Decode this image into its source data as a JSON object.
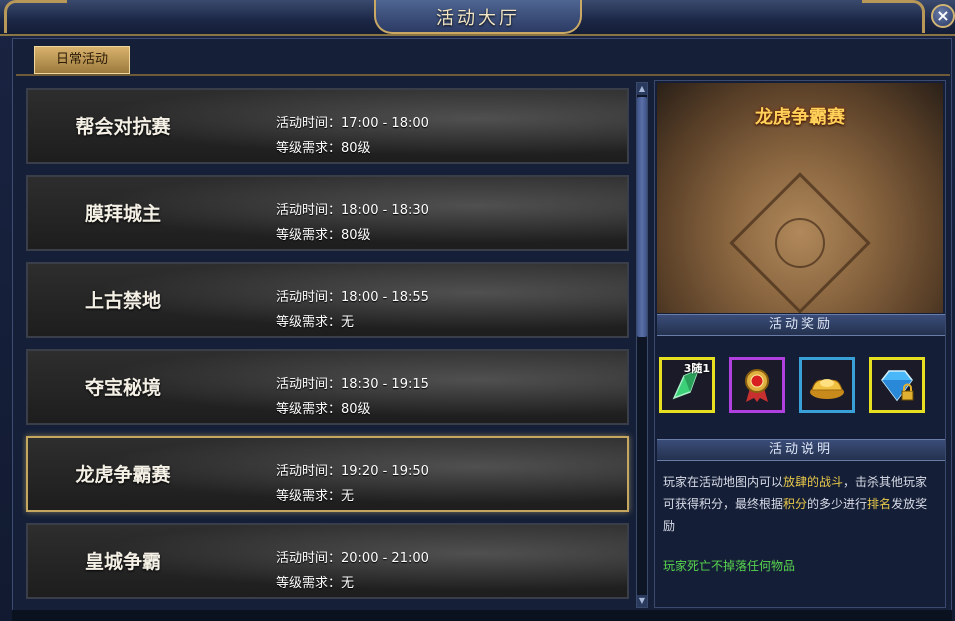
{
  "window": {
    "title": "活动大厅",
    "close_label": "×"
  },
  "tabs": [
    {
      "label": "日常活动",
      "selected": true
    }
  ],
  "activities": [
    {
      "name": "帮会对抗赛",
      "time": "活动时间：17:00 - 18:00",
      "level": "等级需求：80级",
      "selected": false
    },
    {
      "name": "膜拜城主",
      "time": "活动时间：18:00 - 18:30",
      "level": "等级需求：80级",
      "selected": false
    },
    {
      "name": "上古禁地",
      "time": "活动时间：18:00 - 18:55",
      "level": "等级需求：无",
      "selected": false
    },
    {
      "name": "夺宝秘境",
      "time": "活动时间：18:30 - 19:15",
      "level": "等级需求：80级",
      "selected": false
    },
    {
      "name": "龙虎争霸赛",
      "time": "活动时间：19:20 - 19:50",
      "level": "等级需求：无",
      "selected": true
    },
    {
      "name": "皇城争霸",
      "time": "活动时间：20:00 - 21:00",
      "level": "等级需求：无",
      "selected": false
    }
  ],
  "detail": {
    "title": "龙虎争霸赛",
    "rewards_header": "活动奖励",
    "rewards": [
      {
        "icon": "green-crystal-icon",
        "badge": "3随1",
        "rarity_color": "#e6e020"
      },
      {
        "icon": "medal-icon",
        "badge": "",
        "rarity_color": "#b040e0"
      },
      {
        "icon": "gold-ingot-icon",
        "badge": "",
        "rarity_color": "#3aa0d8"
      },
      {
        "icon": "diamond-locked-icon",
        "badge": "",
        "rarity_color": "#e6e020"
      }
    ],
    "description_header": "活动说明",
    "description": {
      "part1": "玩家在活动地图内可以",
      "hl1": "放肆的战斗",
      "part2": "，击杀其他玩家可获得积分，最终根据",
      "hl2": "积分",
      "part3": "的多少进行",
      "hl3": "排名",
      "part4": "发放奖励"
    },
    "note": "玩家死亡不掉落任何物品"
  }
}
